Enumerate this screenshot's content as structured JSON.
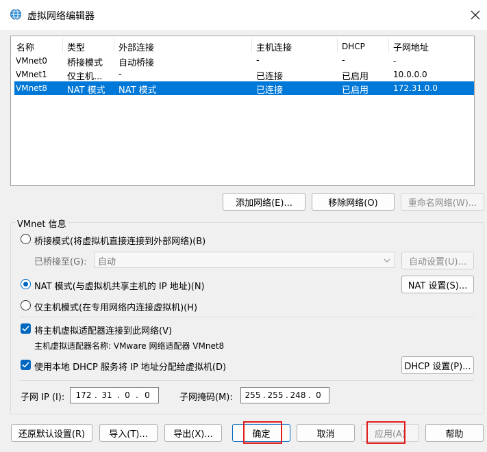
{
  "window": {
    "title": "虚拟网络编辑器"
  },
  "icons": {
    "app": "network-globe-icon",
    "close": "close-icon",
    "dropdown": "chevron-down-icon",
    "check": "checkmark-icon"
  },
  "colors": {
    "selection": "#0078d7",
    "accent": "#0067c0",
    "highlight_box": "#e01c1c"
  },
  "table": {
    "columns": [
      "名称",
      "类型",
      "外部连接",
      "主机连接",
      "DHCP",
      "子网地址"
    ],
    "rows": [
      {
        "name": "VMnet0",
        "type": "桥接模式",
        "external": "自动桥接",
        "host": "-",
        "dhcp": "-",
        "subnet": "-",
        "selected": false
      },
      {
        "name": "VMnet1",
        "type": "仅主机...",
        "external": "-",
        "host": "已连接",
        "dhcp": "已启用",
        "subnet": "10.0.0.0",
        "selected": false
      },
      {
        "name": "VMnet8",
        "type": "NAT 模式",
        "external": "NAT 模式",
        "host": "已连接",
        "dhcp": "已启用",
        "subnet": "172.31.0.0",
        "selected": true
      }
    ]
  },
  "list_buttons": {
    "add": "添加网络(E)...",
    "remove": "移除网络(O)",
    "rename": "重命名网络(W)..."
  },
  "vmnet_info": {
    "group_label": "VMnet 信息",
    "bridged_label": "桥接模式(将虚拟机直接连接到外部网络)(B)",
    "bridged_to_label": "已桥接至(G):",
    "bridged_to_value": "自动",
    "auto_settings": "自动设置(U)...",
    "nat_label": "NAT 模式(与虚拟机共享主机的 IP 地址)(N)",
    "nat_settings": "NAT 设置(S)...",
    "hostonly_label": "仅主机模式(在专用网络内连接虚拟机)(H)",
    "selected_mode": "nat",
    "connect_adapter_label": "将主机虚拟适配器连接到此网络(V)",
    "connect_adapter_checked": true,
    "adapter_name_label": "主机虚拟适配器名称: VMware 网络适配器 VMnet8",
    "dhcp_label": "使用本地 DHCP 服务将 IP 地址分配给虚拟机(D)",
    "dhcp_checked": true,
    "dhcp_settings": "DHCP 设置(P)...",
    "subnet_ip_label": "子网 IP (I):",
    "subnet_ip": [
      "172",
      "31",
      "0",
      "0"
    ],
    "subnet_mask_label": "子网掩码(M):",
    "subnet_mask": [
      "255",
      "255",
      "248",
      "0"
    ]
  },
  "footer": {
    "restore": "还原默认设置(R)",
    "import": "导入(T)...",
    "export": "导出(X)...",
    "ok": "确定",
    "cancel": "取消",
    "apply": "应用(A)",
    "help": "帮助"
  }
}
